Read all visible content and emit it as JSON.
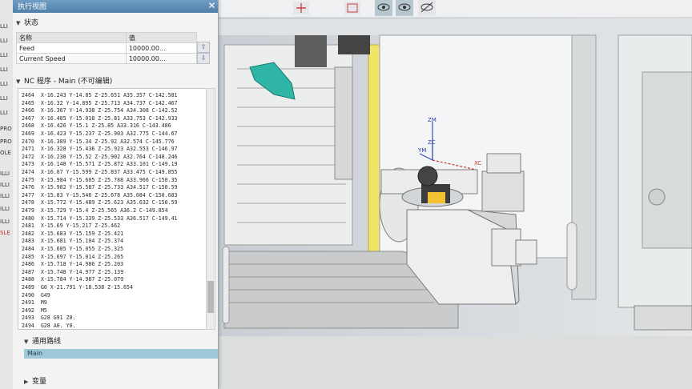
{
  "left_strip": {
    "items": [
      "LLI",
      "LLI",
      "LLI",
      "LLI",
      "LLI",
      "LLI",
      "LLI",
      "PRO",
      "PRO",
      "OLE",
      "ILLI",
      "ILLI",
      "ILLI",
      "ILLI",
      "ILLI",
      "SLE"
    ]
  },
  "panel": {
    "title": "执行视图",
    "status_section": "状态",
    "status_table": {
      "headers": [
        "名称",
        "值"
      ],
      "rows": [
        {
          "name": "Feed",
          "value": "10000.00..."
        },
        {
          "name": "Current Speed",
          "value": "10000.00..."
        }
      ]
    },
    "nc_section": "NC 程序 - Main  (不可编辑)",
    "code_lines": [
      "2464  X-16.243 Y-14.85 Z-25.651 A35.357 C-142.581",
      "2465  X-16.32 Y-14.895 Z-25.713 A34.737 C-142.467",
      "2466  X-16.367 Y-14.938 Z-25.754 A34.308 C-142.52",
      "2467  X-16.405 Y-15.018 Z-25.81 A33.753 C-142.933",
      "2468  X-16.426 Y-15.1 Z-25.85 A33.316 C-143.486",
      "2469  X-16.423 Y-15.237 Z-25.903 A32.775 C-144.67",
      "2470  X-16.389 Y-15.34 Z-25.92 A32.574 C-145.776",
      "2471  X-16.328 Y-15.436 Z-25.923 A32.553 C-146.97",
      "2472  X-16.238 Y-15.52 Z-25.902 A32.764 C-148.246",
      "2473  X-16.148 Y-15.571 Z-25.872 A33.101 C-149.19",
      "2474  X-16.07 Y-15.599 Z-25.837 A33.475 C-149.855",
      "2475  X-15.984 Y-15.605 Z-25.788 A33.966 C-150.35",
      "2476  X-15.902 Y-15.587 Z-25.733 A34.517 C-150.59",
      "2477  X-15.83 Y-15.546 Z-25.678 A35.084 C-150.683",
      "2478  X-15.772 Y-15.489 Z-25.623 A35.632 C-150.59",
      "2479  X-15.729 Y-15.4 Z-25.565 A36.2 C-149.854",
      "2480  X-15.714 Y-15.339 Z-25.533 A36.517 C-149.41",
      "2481  X-15.69 Y-15.217 Z-25.462",
      "2482  X-15.683 Y-15.159 Z-25.421",
      "2483  X-15.681 Y-15.104 Z-25.374",
      "2484  X-15.685 Y-15.055 Z-25.325",
      "2485  X-15.697 Y-15.014 Z-25.265",
      "2486  X-15.718 Y-14.986 Z-25.203",
      "2487  X-15.748 Y-14.977 Z-25.139",
      "2488  X-15.784 Y-14.987 Z-25.079",
      "2489  G0 X-21.791 Y-18.538 Z-15.654",
      "2490  G49",
      "2491  M9",
      "2492  M5",
      "2493  G28 G91 Z0.",
      "2494  G28 A0. Y0.",
      "2495  G90 G28 A0. C0.",
      "2496  M30"
    ],
    "channel_section": "通用路线",
    "channel_item": "Main",
    "var_section": "变量"
  },
  "scene": {
    "axis_labels": {
      "zm": "ZM",
      "zc": "ZC",
      "ym": "YM",
      "xc": "XC"
    },
    "toolbar_icons": [
      "move-icon",
      "fit-icon",
      "view-icon",
      "view-icon",
      "hide-icon"
    ]
  }
}
